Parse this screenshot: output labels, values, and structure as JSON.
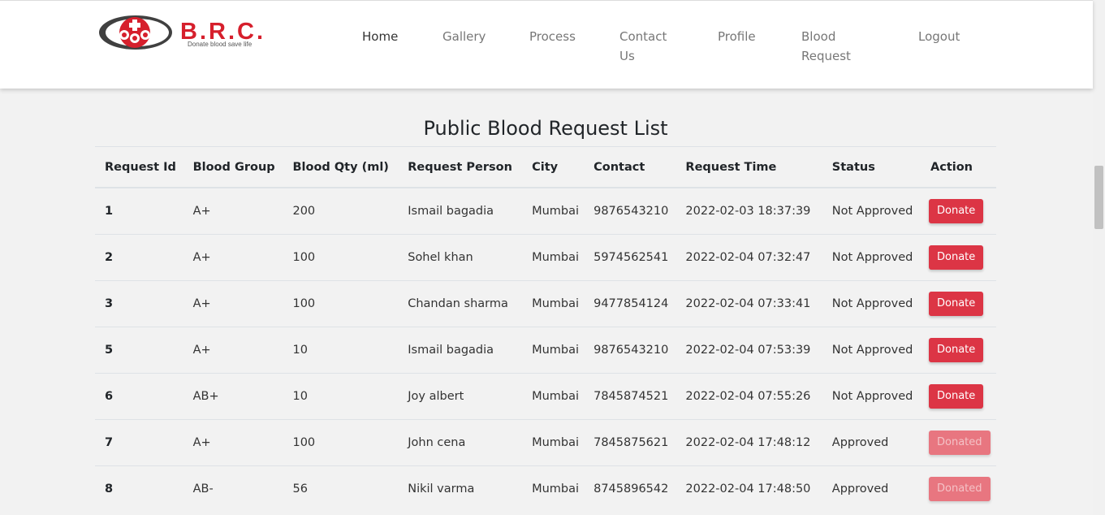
{
  "brand": {
    "logo_text": "B.R.C.",
    "tagline": "Donate blood save life",
    "colors": {
      "primary": "#d61f2c",
      "dark": "#404040"
    }
  },
  "nav": {
    "home": "Home",
    "gallery": "Gallery",
    "process": "Process",
    "contact_line1": "Contact",
    "contact_line2": "Us",
    "profile": "Profile",
    "blood_request_line1": "Blood",
    "blood_request_line2": "Request",
    "logout": "Logout"
  },
  "page": {
    "title": "Public Blood Request List"
  },
  "table": {
    "headers": [
      "Request Id",
      "Blood Group",
      "Blood Qty (ml)",
      "Request Person",
      "City",
      "Contact",
      "Request Time",
      "Status",
      "Action"
    ],
    "rows": [
      {
        "id": "1",
        "group": "A+",
        "qty": "200",
        "person": "Ismail bagadia",
        "city": "Mumbai",
        "contact": "9876543210",
        "time": "2022-02-03 18:37:39",
        "status": "Not Approved",
        "action": "Donate"
      },
      {
        "id": "2",
        "group": "A+",
        "qty": "100",
        "person": "Sohel khan",
        "city": "Mumbai",
        "contact": "5974562541",
        "time": "2022-02-04 07:32:47",
        "status": "Not Approved",
        "action": "Donate"
      },
      {
        "id": "3",
        "group": "A+",
        "qty": "100",
        "person": "Chandan sharma",
        "city": "Mumbai",
        "contact": "9477854124",
        "time": "2022-02-04 07:33:41",
        "status": "Not Approved",
        "action": "Donate"
      },
      {
        "id": "5",
        "group": "A+",
        "qty": "10",
        "person": "Ismail bagadia",
        "city": "Mumbai",
        "contact": "9876543210",
        "time": "2022-02-04 07:53:39",
        "status": "Not Approved",
        "action": "Donate"
      },
      {
        "id": "6",
        "group": "AB+",
        "qty": "10",
        "person": "Joy albert",
        "city": "Mumbai",
        "contact": "7845874521",
        "time": "2022-02-04 07:55:26",
        "status": "Not Approved",
        "action": "Donate"
      },
      {
        "id": "7",
        "group": "A+",
        "qty": "100",
        "person": "John cena",
        "city": "Mumbai",
        "contact": "7845875621",
        "time": "2022-02-04 17:48:12",
        "status": "Approved",
        "action": "Donated"
      },
      {
        "id": "8",
        "group": "AB-",
        "qty": "56",
        "person": "Nikil varma",
        "city": "Mumbai",
        "contact": "8745896542",
        "time": "2022-02-04 17:48:50",
        "status": "Approved",
        "action": "Donated"
      }
    ]
  },
  "colors": {
    "donate_button": "#dc3545",
    "donated_button": "#e87680",
    "background": "#f2f2f2"
  }
}
